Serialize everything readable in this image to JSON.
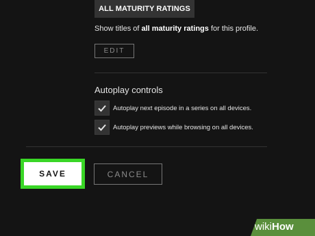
{
  "maturity": {
    "badge_label": "ALL MATURITY RATINGS",
    "description_prefix": "Show titles of ",
    "description_bold": "all maturity ratings",
    "description_suffix": " for this profile.",
    "edit_label": "EDIT"
  },
  "autoplay": {
    "title": "Autoplay controls",
    "options": [
      {
        "label": "Autoplay next episode in a series on all devices.",
        "checked": true
      },
      {
        "label": "Autoplay previews while browsing on all devices.",
        "checked": true
      }
    ]
  },
  "actions": {
    "save_label": "SAVE",
    "cancel_label": "CANCEL"
  },
  "watermark": {
    "part1": "wiki",
    "part2": "How"
  },
  "colors": {
    "background": "#141414",
    "highlight": "#39d626",
    "watermark": "#5a8f3c"
  }
}
